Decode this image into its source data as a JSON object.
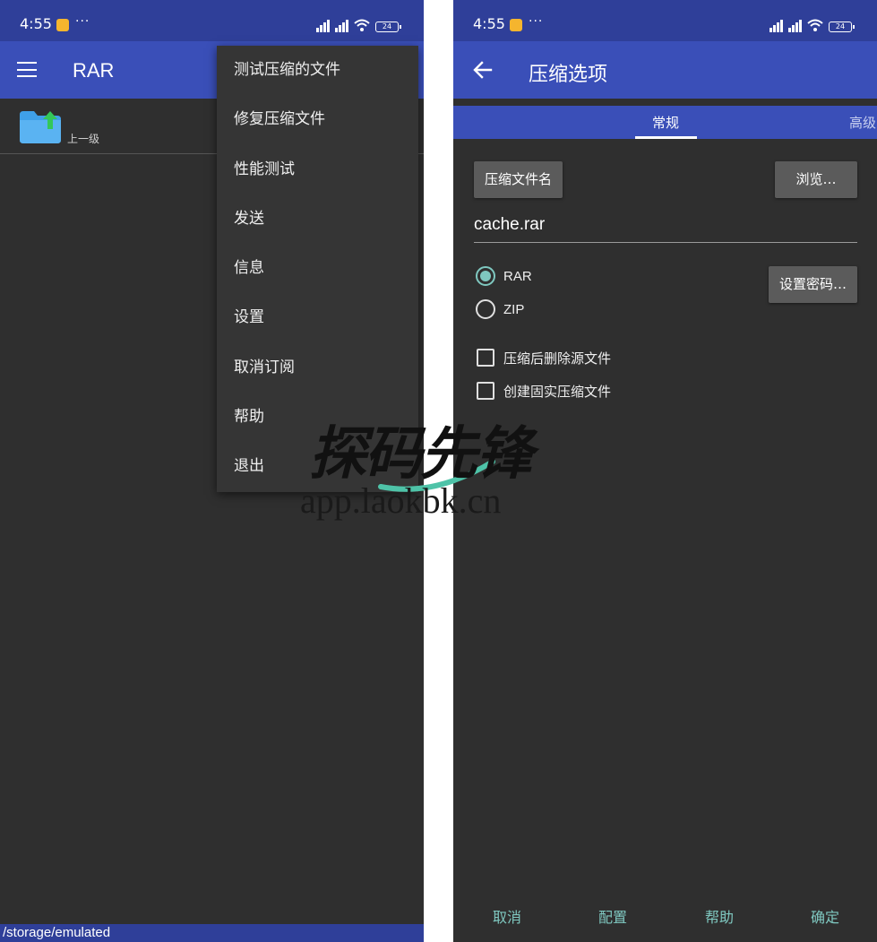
{
  "left": {
    "status": {
      "time": "4:55",
      "dots": "···",
      "battery": "24"
    },
    "appbar": {
      "title": "RAR"
    },
    "file_list": [
      {
        "label": "上一级"
      }
    ],
    "menu": {
      "items": [
        {
          "label": "测试压缩的文件"
        },
        {
          "label": "修复压缩文件"
        },
        {
          "label": "性能测试"
        },
        {
          "label": "发送"
        },
        {
          "label": "信息"
        },
        {
          "label": "设置"
        },
        {
          "label": "取消订阅"
        },
        {
          "label": "帮助"
        },
        {
          "label": "退出"
        }
      ]
    },
    "path": "/storage/emulated"
  },
  "right": {
    "status": {
      "time": "4:55",
      "dots": "···",
      "battery": "24"
    },
    "appbar": {
      "title": "压缩选项"
    },
    "tabs": {
      "general": "常规",
      "advanced": "高级"
    },
    "archive_name_button": "压缩文件名",
    "browse_button": "浏览…",
    "filename": "cache.rar",
    "formats": [
      {
        "label": "RAR",
        "checked": true
      },
      {
        "label": "ZIP",
        "checked": false
      }
    ],
    "password_button": "设置密码…",
    "options": [
      {
        "label": "压缩后删除源文件",
        "checked": false
      },
      {
        "label": "创建固实压缩文件",
        "checked": false
      }
    ],
    "footer": {
      "cancel": "取消",
      "profiles": "配置",
      "help": "帮助",
      "ok": "确定"
    }
  },
  "watermark": {
    "title": "探码先锋",
    "url": "app.laokbk.cn"
  },
  "colors": {
    "primary": "#3a4fb8",
    "statusbar": "#2f3f99",
    "background": "#2f2f2f",
    "accent": "#7fc8c0"
  }
}
